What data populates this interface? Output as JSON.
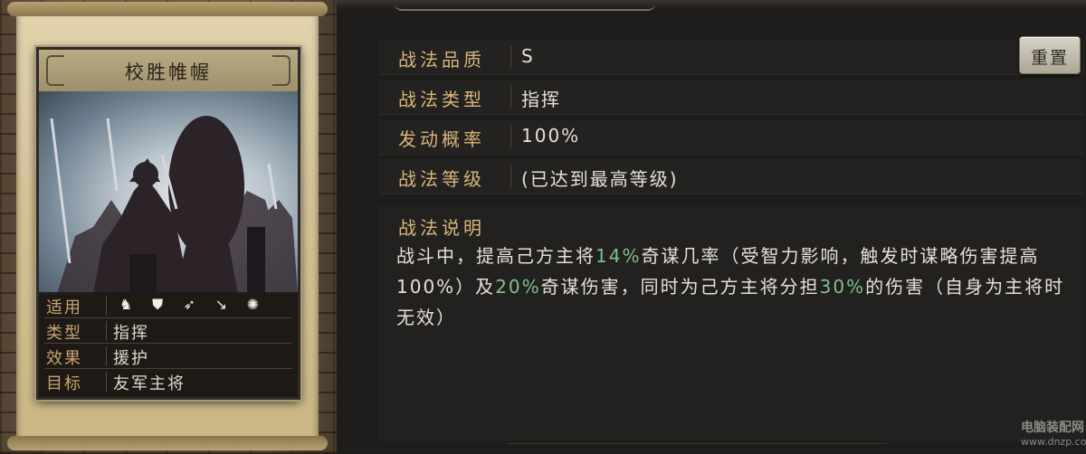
{
  "card": {
    "title": "校胜帷幄",
    "rows": [
      {
        "label": "适用",
        "value": ""
      },
      {
        "label": "类型",
        "value": "指挥"
      },
      {
        "label": "效果",
        "value": "援护"
      },
      {
        "label": "目标",
        "value": "友军主将"
      }
    ],
    "unit_icons": [
      "cavalry-icon",
      "shield-icon",
      "bow-icon",
      "spear-icon",
      "siege-wheel-icon"
    ]
  },
  "details": {
    "rows": [
      {
        "label": "战法品质",
        "value": "S"
      },
      {
        "label": "战法类型",
        "value": "指挥"
      },
      {
        "label": "发动概率",
        "value": "100%"
      },
      {
        "label": "战法等级",
        "value": "(已达到最高等级)"
      }
    ],
    "description_title": "战法说明",
    "description": {
      "p1": "战斗中，提高己方主将",
      "v1": "14%",
      "p2": "奇谋几率（受智力影响，触发时谋略伤害提高100%）及",
      "v2": "20%",
      "p3": "奇谋伤害，同时为己方主将分担",
      "v3": "30%",
      "p4": "的伤害（自身为主将时无效）"
    },
    "highlight_color": "#7ec08c"
  },
  "reset_button": {
    "label": "重置"
  },
  "watermark": {
    "line1": "电脑装配网",
    "line2": "www.dnzp.com"
  }
}
